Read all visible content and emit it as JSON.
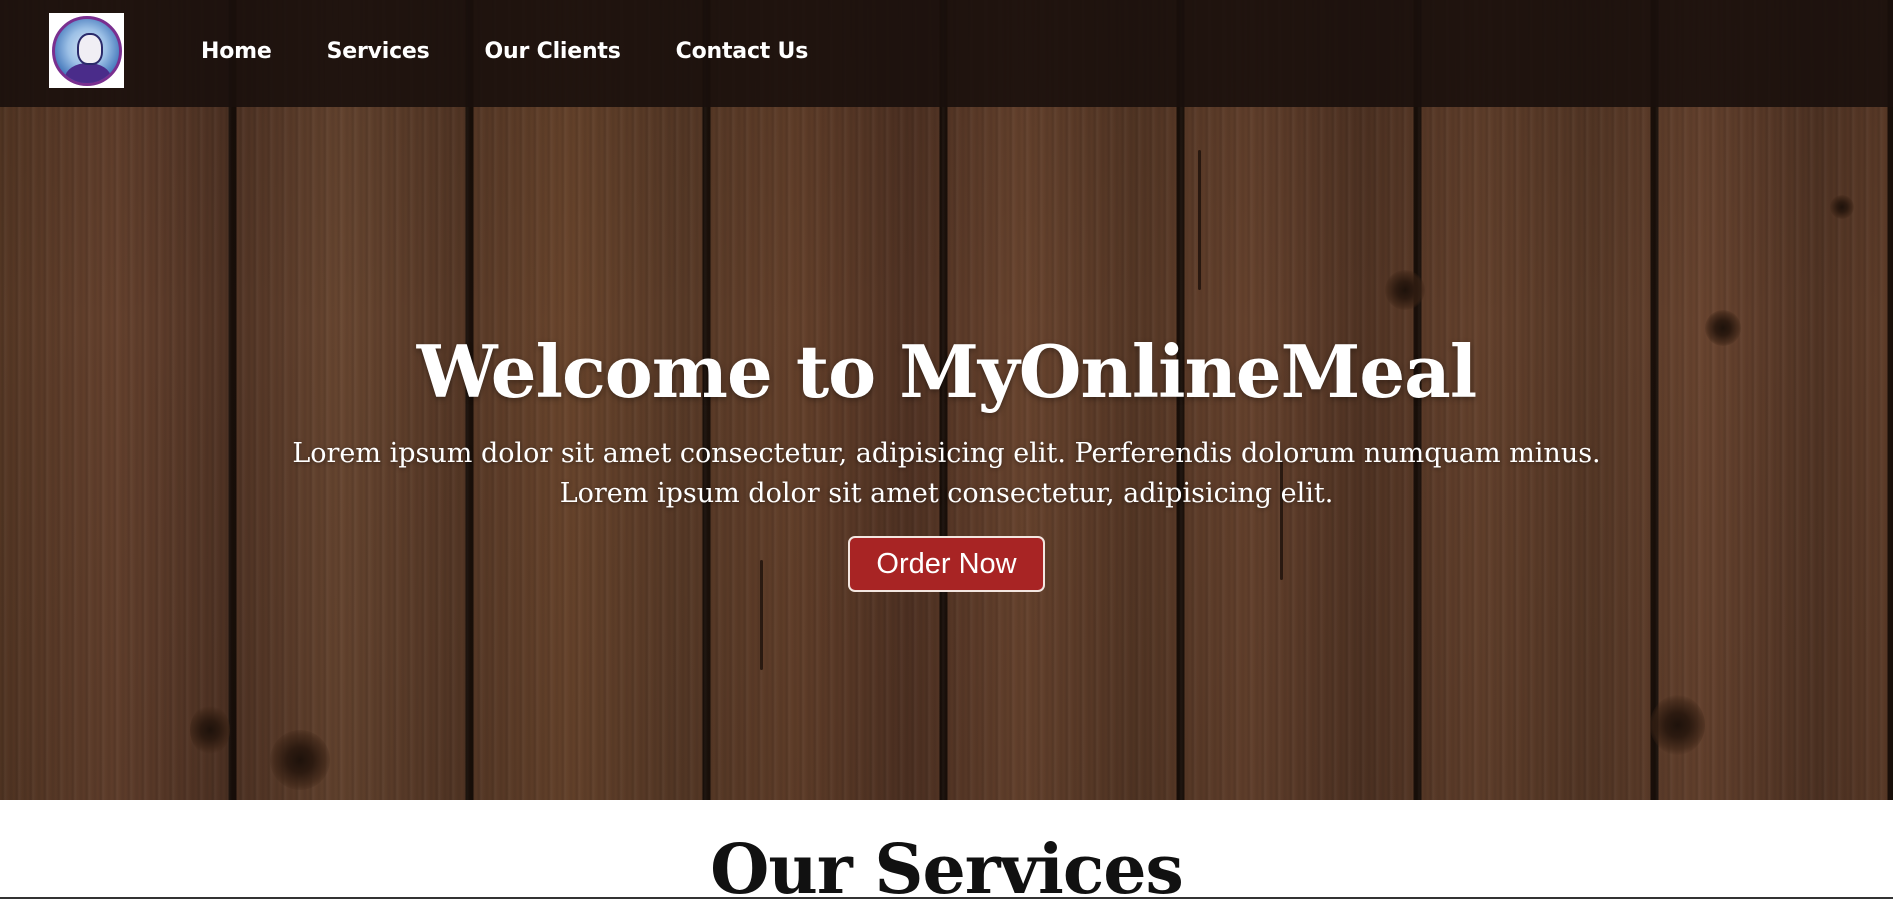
{
  "nav": {
    "items": [
      {
        "label": "Home"
      },
      {
        "label": "Services"
      },
      {
        "label": "Our Clients"
      },
      {
        "label": "Contact Us"
      }
    ]
  },
  "hero": {
    "title": "Welcome to MyOnlineMeal",
    "text_line1": "Lorem ipsum dolor sit amet consectetur, adipisicing elit. Perferendis dolorum numquam minus.",
    "text_line2": "Lorem ipsum dolor sit amet consectetur, adipisicing elit.",
    "button_label": "Order Now"
  },
  "services": {
    "title": "Our Services"
  },
  "colors": {
    "navbar_bg": "#19100c",
    "button_bg": "#a82424",
    "text_light": "#ffffff",
    "text_dark": "#111111"
  }
}
